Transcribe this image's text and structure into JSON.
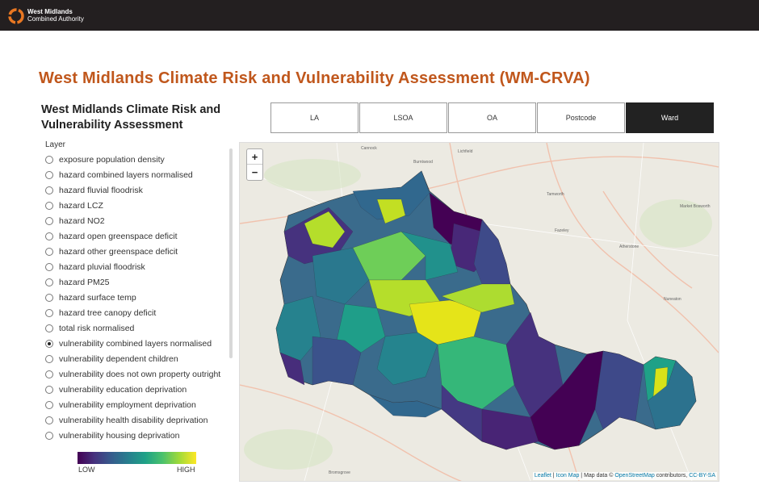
{
  "header": {
    "org_line1": "West Midlands",
    "org_line2": "Combined Authority"
  },
  "page_title": "West Midlands Climate Risk and Vulnerability Assessment (WM-CRVA)",
  "panel": {
    "title": "West Midlands Climate Risk and Vulnerability Assessment",
    "layer_label": "Layer",
    "layers": [
      {
        "label": "exposure population density",
        "checked": false
      },
      {
        "label": "hazard combined layers normalised",
        "checked": false
      },
      {
        "label": "hazard fluvial floodrisk",
        "checked": false
      },
      {
        "label": "hazard LCZ",
        "checked": false
      },
      {
        "label": "hazard NO2",
        "checked": false
      },
      {
        "label": "hazard open greenspace deficit",
        "checked": false
      },
      {
        "label": "hazard other greenspace deficit",
        "checked": false
      },
      {
        "label": "hazard pluvial floodrisk",
        "checked": false
      },
      {
        "label": "hazard PM25",
        "checked": false
      },
      {
        "label": "hazard surface temp",
        "checked": false
      },
      {
        "label": "hazard tree canopy deficit",
        "checked": false
      },
      {
        "label": "total risk normalised",
        "checked": false
      },
      {
        "label": "vulnerability combined layers normalised",
        "checked": true
      },
      {
        "label": "vulnerability dependent children",
        "checked": false
      },
      {
        "label": "vulnerability does not own property outright",
        "checked": false
      },
      {
        "label": "vulnerability education deprivation",
        "checked": false
      },
      {
        "label": "vulnerability employment deprivation",
        "checked": false
      },
      {
        "label": "vulnerability health disability deprivation",
        "checked": false
      },
      {
        "label": "vulnerability housing deprivation",
        "checked": false
      }
    ],
    "legend": {
      "low": "LOW",
      "high": "HIGH"
    }
  },
  "tabs": [
    {
      "label": "LA",
      "active": false
    },
    {
      "label": "LSOA",
      "active": false
    },
    {
      "label": "OA",
      "active": false
    },
    {
      "label": "Postcode",
      "active": false
    },
    {
      "label": "Ward",
      "active": true
    }
  ],
  "map": {
    "zoom_in": "+",
    "zoom_out": "−",
    "places": [
      "Cannock",
      "Burntwood",
      "Lichfield",
      "Tamworth",
      "Fazeley",
      "Atherstone",
      "Nuneaton",
      "Market Bosworth",
      "Bromsgrove"
    ],
    "attribution": {
      "leaflet": "Leaflet",
      "icon_map": "Icon Map",
      "map_data": "Map data ©",
      "osm": "OpenStreetMap",
      "contributors": "contributors,",
      "license": "CC-BY-SA"
    }
  }
}
